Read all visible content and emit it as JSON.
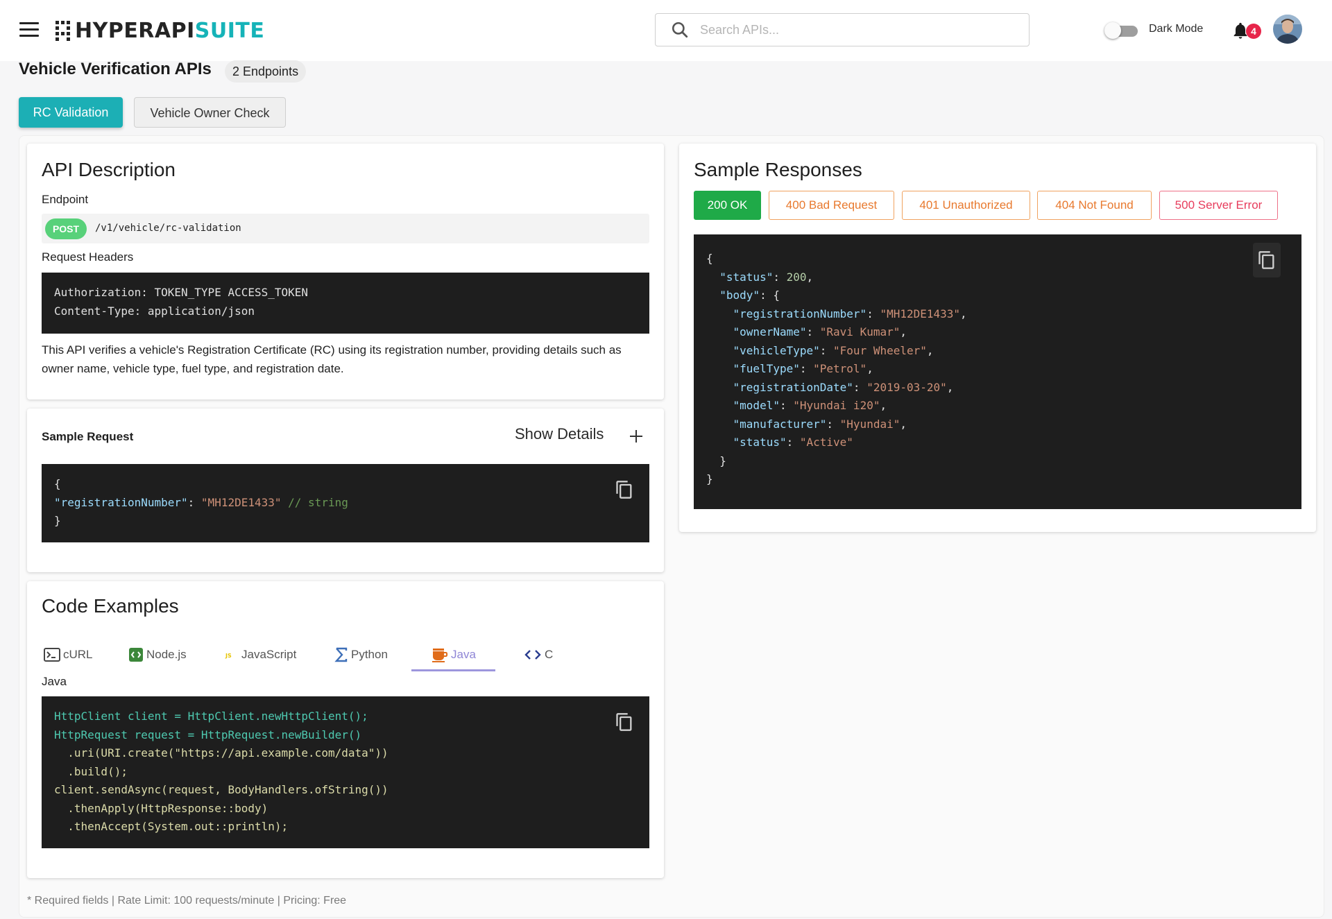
{
  "header": {
    "logo_primary": "HYPERAPI",
    "logo_accent": "SUITE",
    "search_placeholder": "Search APIs...",
    "dark_mode_label": "Dark Mode",
    "notification_count": "4"
  },
  "page": {
    "title": "Vehicle Verification APIs",
    "endpoint_count": "2 Endpoints",
    "tabs": [
      {
        "label": "RC Validation",
        "active": true
      },
      {
        "label": "Vehicle Owner Check",
        "active": false
      }
    ]
  },
  "description": {
    "heading": "API Description",
    "endpoint_label": "Endpoint",
    "method": "POST",
    "path": "/v1/vehicle/rc-validation",
    "headers_label": "Request Headers",
    "headers": [
      "Authorization: TOKEN_TYPE ACCESS_TOKEN",
      "Content-Type: application/json"
    ],
    "text": "This API verifies a vehicle's Registration Certificate (RC) using its registration number, providing details such as owner name, vehicle type, fuel type, and registration date."
  },
  "sample_request": {
    "title": "Sample Request",
    "show_details": "Show Details",
    "open_brace": "{",
    "key": "\"registrationNumber\"",
    "sep": ": ",
    "value": "\"MH12DE1433\"",
    "comment": " // string",
    "close_brace": "}"
  },
  "code_examples": {
    "heading": "Code Examples",
    "tabs": [
      {
        "label": "cURL",
        "icon": "terminal-icon"
      },
      {
        "label": "Node.js",
        "icon": "nodejs-icon"
      },
      {
        "label": "JavaScript",
        "icon": "javascript-icon"
      },
      {
        "label": "Python",
        "icon": "sigma-icon"
      },
      {
        "label": "Java",
        "icon": "coffee-cup-icon",
        "active": true
      },
      {
        "label": "C",
        "icon": "code-brackets-icon"
      }
    ],
    "selected_language": "Java",
    "code_lines": [
      "HttpClient client = HttpClient.newHttpClient();",
      "HttpRequest request = HttpRequest.newBuilder()",
      "  .uri(URI.create(\"https://api.example.com/data\"))",
      "  .build();",
      "client.sendAsync(request, BodyHandlers.ofString())",
      "  .thenApply(HttpResponse::body)",
      "  .thenAccept(System.out::println);"
    ]
  },
  "sample_responses": {
    "heading": "Sample Responses",
    "status_buttons": [
      {
        "label": "200 OK",
        "color": "#1faa48"
      },
      {
        "label": "400 Bad Request",
        "color": "#e8792e"
      },
      {
        "label": "401 Unauthorized",
        "color": "#e8792e"
      },
      {
        "label": "404 Not Found",
        "color": "#e8792e"
      },
      {
        "label": "500 Server Error",
        "color": "#e73c5c"
      }
    ],
    "body_fields": [
      {
        "key": "\"registrationNumber\"",
        "value": "\"MH12DE1433\""
      },
      {
        "key": "\"ownerName\"",
        "value": "\"Ravi Kumar\""
      },
      {
        "key": "\"vehicleType\"",
        "value": "\"Four Wheeler\""
      },
      {
        "key": "\"fuelType\"",
        "value": "\"Petrol\""
      },
      {
        "key": "\"registrationDate\"",
        "value": "\"2019-03-20\""
      },
      {
        "key": "\"model\"",
        "value": "\"Hyundai i20\""
      },
      {
        "key": "\"manufacturer\"",
        "value": "\"Hyundai\""
      },
      {
        "key": "\"status\"",
        "value": "\"Active\""
      }
    ],
    "status_key": "\"status\"",
    "status_value": "200",
    "body_key": "\"body\""
  },
  "footer": {
    "note": "* Required fields | Rate Limit: 100 requests/minute | Pricing: Free"
  },
  "colors": {
    "accent": "#1cafb5",
    "success": "#1faa48",
    "warning": "#e8792e",
    "error": "#e73c5c",
    "code_bg": "#1e1e1e"
  }
}
